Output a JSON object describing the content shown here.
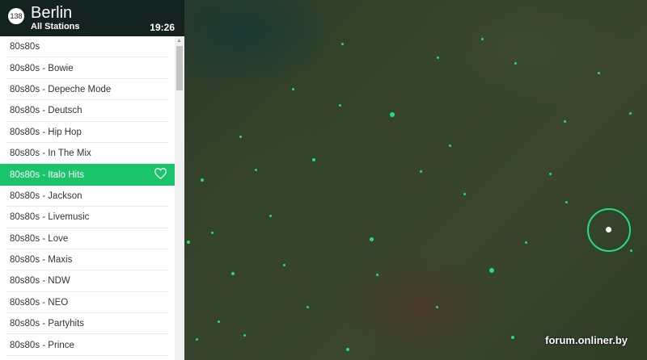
{
  "header": {
    "station_count": "138",
    "city": "Berlin",
    "subtitle": "All Stations",
    "time": "19:26"
  },
  "stations": [
    "80s80s",
    "80s80s - Bowie",
    "80s80s - Depeche Mode",
    "80s80s - Deutsch",
    "80s80s - Hip Hop",
    "80s80s - In The Mix",
    "80s80s - Italo Hits",
    "80s80s - Jackson",
    "80s80s - Livemusic",
    "80s80s - Love",
    "80s80s - Maxis",
    "80s80s - NDW",
    "80s80s - NEO",
    "80s80s - Partyhits",
    "80s80s - Prince"
  ],
  "selected_index": 6,
  "accent_color": "#19c46a",
  "icons": {
    "favorite": "heart-icon"
  },
  "watermark": "forum.onliner.by"
}
